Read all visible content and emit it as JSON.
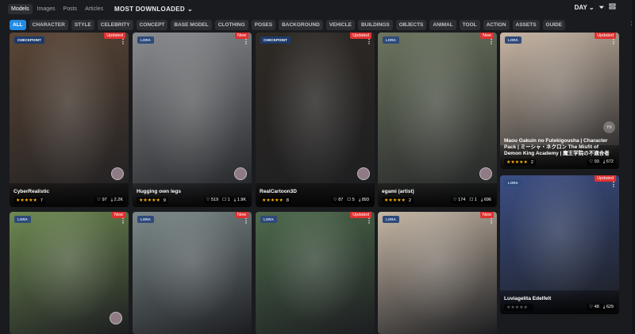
{
  "tabs": [
    {
      "label": "Models",
      "active": true
    },
    {
      "label": "Images",
      "active": false
    },
    {
      "label": "Posts",
      "active": false
    },
    {
      "label": "Articles",
      "active": false
    }
  ],
  "sort_label": "MOST DOWNLOADED",
  "period_label": "DAY",
  "tags": [
    "ALL",
    "CHARACTER",
    "STYLE",
    "CELEBRITY",
    "CONCEPT",
    "BASE MODEL",
    "CLOTHING",
    "POSES",
    "BACKGROUND",
    "VEHICLE",
    "BUILDINGS",
    "OBJECTS",
    "ANIMAL",
    "TOOL",
    "ACTION",
    "ASSETS",
    "GUIDE"
  ],
  "cards": [
    {
      "type": "CHECKPOINT",
      "flag": "Updated",
      "title": "CyberRealistic",
      "rating_count": "7",
      "likes": "97",
      "comments": "",
      "downloads": "2.2K",
      "bg": "#5b4636"
    },
    {
      "type": "LORA",
      "flag": "New",
      "title": "Hugging own legs",
      "rating_count": "9",
      "likes": "519",
      "comments": "1",
      "downloads": "1.9K",
      "bg": "#8a8c8f"
    },
    {
      "type": "CHECKPOINT",
      "flag": "Updated",
      "title": "RealCartoon3D",
      "rating_count": "8",
      "likes": "87",
      "comments": "5",
      "downloads": "893",
      "bg": "#2f2a25"
    },
    {
      "type": "LORA",
      "flag": "New",
      "title": "egami (artist)",
      "rating_count": "2",
      "likes": "174",
      "comments": "1",
      "downloads": "696",
      "bg": "#6d7560"
    },
    {
      "type": "LORA",
      "flag": "Updated",
      "title": "Maou Gakuin no Futekigousha | Character Pack | ミーシャ・ネクロン The Misfit of Demon King Academy | 魔王学院の不適合者",
      "rating_count": "2",
      "likes": "93",
      "comments": "",
      "downloads": "672",
      "bg": "#c9b7a5"
    },
    {
      "type": "LORA",
      "flag": "New",
      "title": "",
      "rating_count": "",
      "likes": "",
      "comments": "",
      "downloads": "",
      "bg": "#6f8a52"
    },
    {
      "type": "LORA",
      "flag": "New",
      "title": "",
      "rating_count": "",
      "likes": "",
      "comments": "",
      "downloads": "",
      "bg": "#7d8a8a"
    },
    {
      "type": "LORA",
      "flag": "Updated",
      "title": "",
      "rating_count": "",
      "likes": "",
      "comments": "",
      "downloads": "",
      "bg": "#4e6a4c"
    },
    {
      "type": "LORA",
      "flag": "New",
      "title": "",
      "rating_count": "",
      "likes": "",
      "comments": "",
      "downloads": "",
      "bg": "#c7b8a6"
    },
    {
      "type": "LORA",
      "flag": "Updated",
      "title": "Luviagelita Edelfelt",
      "rating_count": "",
      "likes": "48",
      "comments": "",
      "downloads": "629",
      "bg": "#3c4f86"
    }
  ],
  "badge_yx": "YX",
  "icons": {
    "heart": "♡",
    "comment": "☐",
    "download": "⤓",
    "dots": "⋮",
    "chevron": "⌄",
    "filter": "⏷",
    "next": "›"
  }
}
